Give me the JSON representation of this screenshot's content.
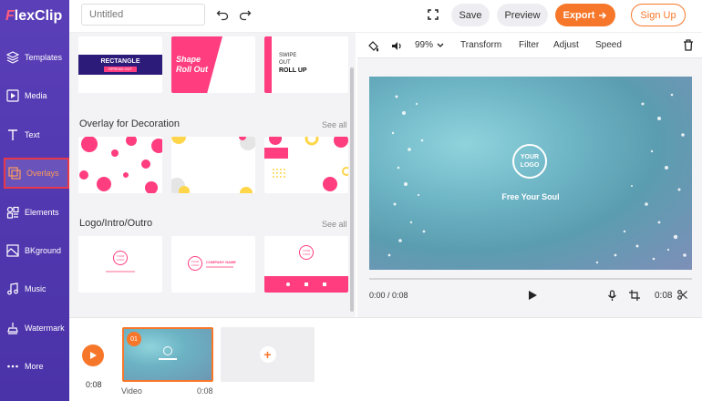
{
  "app": {
    "logo_text": "lexClip",
    "logo_letter": "F"
  },
  "sidebar": {
    "items": [
      {
        "label": "Templates",
        "icon": "layers-icon"
      },
      {
        "label": "Media",
        "icon": "media-icon"
      },
      {
        "label": "Text",
        "icon": "text-icon"
      },
      {
        "label": "Overlays",
        "icon": "overlays-icon",
        "active": true
      },
      {
        "label": "Elements",
        "icon": "elements-icon"
      },
      {
        "label": "BKground",
        "icon": "background-icon"
      },
      {
        "label": "Music",
        "icon": "music-icon"
      },
      {
        "label": "Watermark",
        "icon": "watermark-icon"
      },
      {
        "label": "More",
        "icon": "more-icon"
      }
    ]
  },
  "topbar": {
    "title_placeholder": "Untitled",
    "save_label": "Save",
    "preview_label": "Preview",
    "export_label": "Export",
    "signup_label": "Sign Up"
  },
  "panel": {
    "top_cards": [
      {
        "line1": "RECTANGLE",
        "line2": "SPREAD OUT"
      },
      {
        "line1": "Shape",
        "line2": "Roll Out"
      },
      {
        "line1": "SWIPE",
        "line2": "OUT",
        "line3": "ROLL UP"
      }
    ],
    "sections": [
      {
        "title": "Overlay for Decoration",
        "see_all": "See all"
      },
      {
        "title": "Logo/Intro/Outro",
        "see_all": "See all"
      }
    ],
    "logo_cards": [
      {
        "logo": "YOUR LOGO",
        "text": ""
      },
      {
        "logo": "YOUR LOGO",
        "text": "COMPANY NAME"
      },
      {
        "logo": "YOUR LOGO",
        "text": ""
      }
    ]
  },
  "toolbar": {
    "zoom": "99%",
    "transform": "Transform",
    "filter": "Filter",
    "adjust": "Adjust",
    "speed": "Speed"
  },
  "preview": {
    "logo_text": "YOUR LOGO",
    "tagline": "Free Your Soul",
    "current_time": "0:00 / 0:08",
    "duration": "0:08"
  },
  "timeline": {
    "time": "0:08",
    "clip_number": "01",
    "clip_label": "Video",
    "clip_duration": "0:08"
  },
  "colors": {
    "sidebar": "#4a32a8",
    "accent": "#f7772a",
    "pink": "#ff3d7f"
  }
}
